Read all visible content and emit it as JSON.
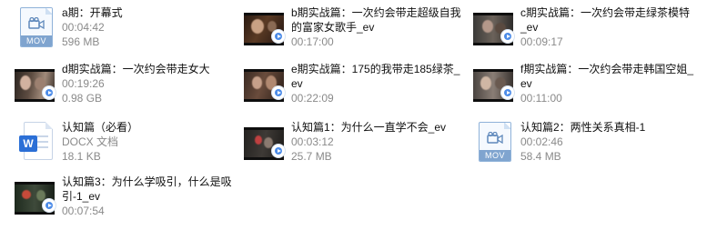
{
  "files": [
    {
      "id": "a-opening",
      "title": "a期：开幕式",
      "line2": "00:04:42",
      "line3": "596 MB",
      "icon": "mov-file-icon",
      "badge": "MOV"
    },
    {
      "id": "b-practice",
      "title": "b期实战篇：一次约会带走超级自我的富家女歌手_ev",
      "line2": "00:17:00",
      "line3": "",
      "icon": "video-thumbnail-icon"
    },
    {
      "id": "c-practice",
      "title": "c期实战篇：一次约会带走绿茶模特_ev",
      "line2": "00:09:17",
      "line3": "",
      "icon": "video-thumbnail-icon"
    },
    {
      "id": "d-practice",
      "title": "d期实战篇：一次约会带走女大",
      "line2": "00:19:26",
      "line3": "0.98 GB",
      "icon": "video-thumbnail-icon"
    },
    {
      "id": "e-practice",
      "title": "e期实战篇：175的我带走185绿茶_ev",
      "line2": "00:22:09",
      "line3": "",
      "icon": "video-thumbnail-icon"
    },
    {
      "id": "f-practice",
      "title": "f期实战篇：一次约会带走韩国空姐_ev",
      "line2": "00:11:00",
      "line3": "",
      "icon": "video-thumbnail-icon"
    },
    {
      "id": "cognition-required",
      "title": "认知篇（必看）",
      "line2": "DOCX 文档",
      "line3": "18.1 KB",
      "icon": "docx-file-icon",
      "badge": "W"
    },
    {
      "id": "cognition-1",
      "title": "认知篇1：为什么一直学不会_ev",
      "line2": "00:03:12",
      "line3": "25.7 MB",
      "icon": "video-thumbnail-icon"
    },
    {
      "id": "cognition-2",
      "title": "认知篇2：两性关系真相-1",
      "line2": "00:02:46",
      "line3": "58.4 MB",
      "icon": "mov-file-icon",
      "badge": "MOV"
    },
    {
      "id": "cognition-3",
      "title": "认知篇3：为什么学吸引，什么是吸引-1_ev",
      "line2": "00:07:54",
      "line3": "",
      "icon": "video-thumbnail-icon"
    }
  ],
  "colors": {
    "accent": "#4d8ce8",
    "mov_band": "#7fa4cf",
    "word_blue": "#2b6fd6",
    "meta_gray": "#8a8a8a"
  }
}
